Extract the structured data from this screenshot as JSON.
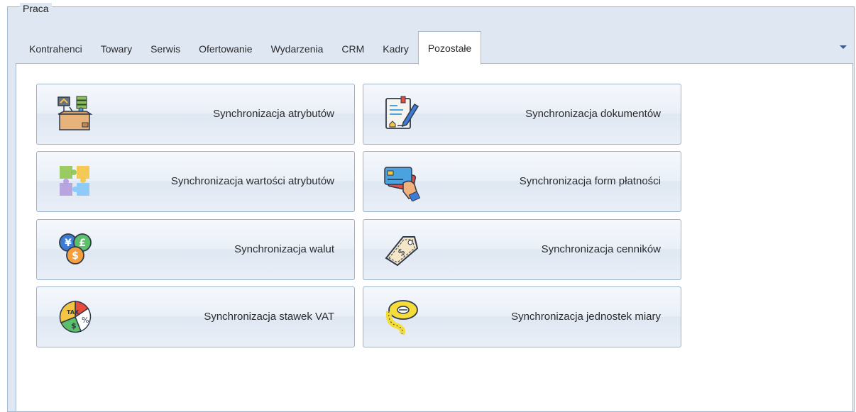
{
  "group": {
    "title": "Praca"
  },
  "tabs": [
    {
      "label": "Kontrahenci"
    },
    {
      "label": "Towary"
    },
    {
      "label": "Serwis"
    },
    {
      "label": "Ofertowanie"
    },
    {
      "label": "Wydarzenia"
    },
    {
      "label": "CRM"
    },
    {
      "label": "Kadry"
    },
    {
      "label": "Pozostałe",
      "active": true
    }
  ],
  "buttons": {
    "attributes": {
      "label": "Synchronizacja atrybutów",
      "icon": "boxes-icon"
    },
    "documents": {
      "label": "Synchronizacja dokumentów",
      "icon": "document-pen-icon"
    },
    "attribute_values": {
      "label": "Synchronizacja wartości atrybutów",
      "icon": "puzzle-icon"
    },
    "payment_forms": {
      "label": "Synchronizacja form płatności",
      "icon": "credit-card-hand-icon"
    },
    "currencies": {
      "label": "Synchronizacja walut",
      "icon": "currency-coins-icon"
    },
    "price_lists": {
      "label": "Synchronizacja cenników",
      "icon": "price-tag-icon"
    },
    "vat_rates": {
      "label": "Synchronizacja stawek VAT",
      "icon": "tax-pie-icon"
    },
    "units": {
      "label": "Synchronizacja jednostek miary",
      "icon": "measuring-tape-icon"
    }
  },
  "dropdown": {
    "icon": "chevron-down-icon"
  }
}
